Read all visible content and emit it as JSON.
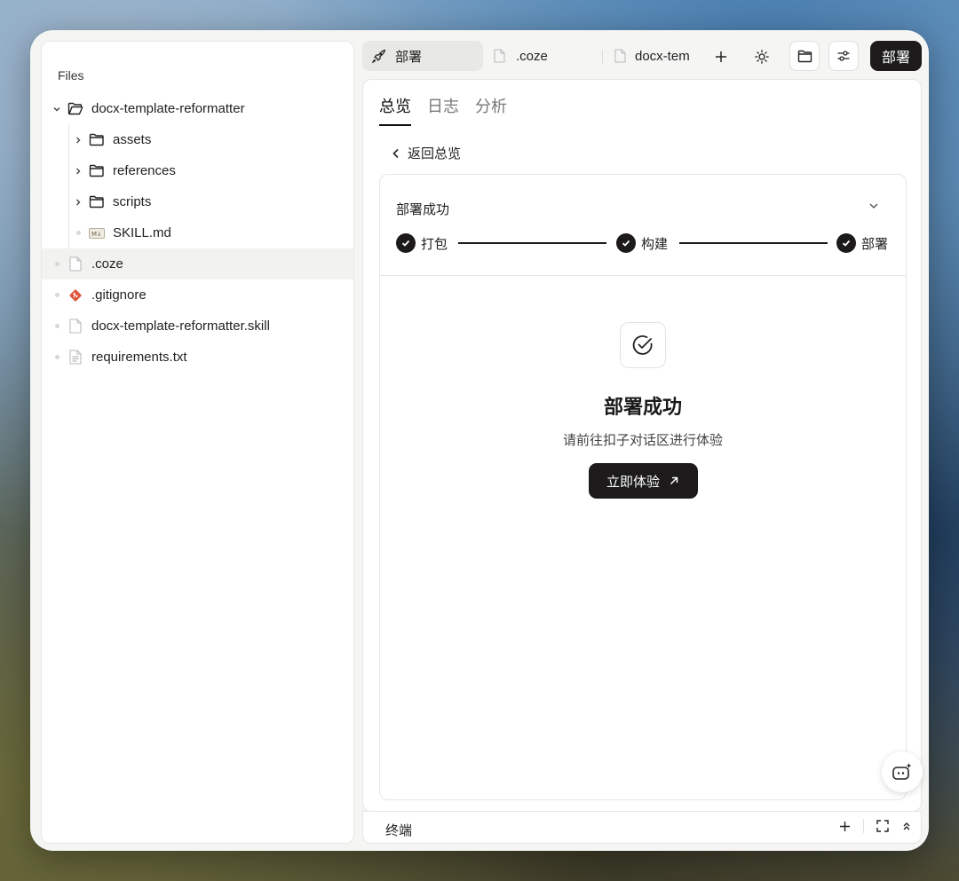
{
  "sidebar": {
    "title": "Files",
    "items": [
      {
        "label": "docx-template-reformatter",
        "type": "folder-open"
      },
      {
        "label": "assets",
        "type": "folder"
      },
      {
        "label": "references",
        "type": "folder"
      },
      {
        "label": "scripts",
        "type": "folder"
      },
      {
        "label": "SKILL.md",
        "type": "markdown"
      },
      {
        "label": ".coze",
        "type": "file"
      },
      {
        "label": ".gitignore",
        "type": "git"
      },
      {
        "label": "docx-template-reformatter.skill",
        "type": "file"
      },
      {
        "label": "requirements.txt",
        "type": "text"
      }
    ]
  },
  "tabs": [
    {
      "label": "部署",
      "icon": "rocket-icon"
    },
    {
      "label": ".coze",
      "icon": "file-icon"
    },
    {
      "label": "docx-tem",
      "icon": "file-icon"
    }
  ],
  "toolbar": {
    "deploy_label": "部署"
  },
  "subtabs": [
    "总览",
    "日志",
    "分析"
  ],
  "back_label": "返回总览",
  "card": {
    "title": "部署成功",
    "steps": [
      "打包",
      "构建",
      "部署"
    ]
  },
  "success": {
    "title": "部署成功",
    "subtitle": "请前往扣子对话区进行体验",
    "button_label": "立即体验"
  },
  "terminal": {
    "label": "终端"
  },
  "colors": {
    "accent_dark": "#1c1a1a",
    "git_orange": "#e0553a"
  }
}
